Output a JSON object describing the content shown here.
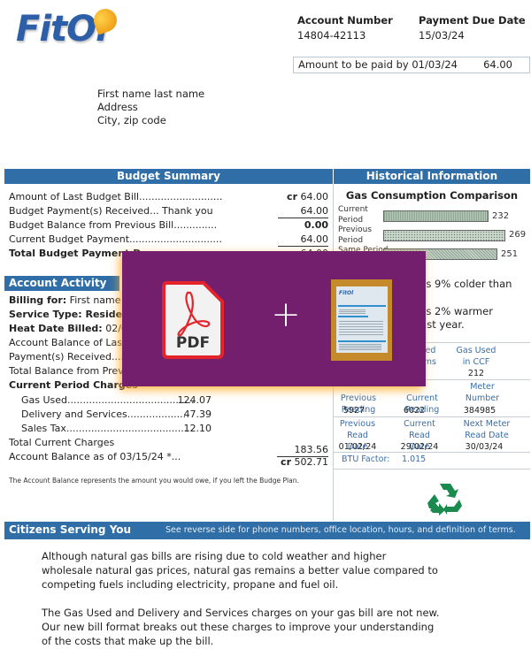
{
  "brand": {
    "logo_text": "FitOl",
    "accent_color": "#2f6ea6"
  },
  "account": {
    "number_label": "Account Number",
    "number": "14804-42113",
    "due_label": "Payment Due Date",
    "due_date": "15/03/24",
    "amount_label": "Amount to be paid by 01/03/24",
    "amount": "64.00"
  },
  "address": {
    "name": "First name last name",
    "street": "Address",
    "city": "City, zip code"
  },
  "budget_summary": {
    "title": "Budget Summary",
    "rows": [
      {
        "label": "Amount of Last Budget Bill...........................",
        "prefix": "cr",
        "value": "64.00"
      },
      {
        "label": "Budget Payment(s) Received... Thank you",
        "prefix": "",
        "value": "64.00"
      },
      {
        "label": "Budget Balance from Previous Bill..............",
        "prefix": "",
        "value": "0.00"
      },
      {
        "label": "Current Budget Payment..............................",
        "prefix": "",
        "value": "64.00"
      },
      {
        "label": "Total Budget Payment D",
        "prefix": "",
        "value": "64.00"
      }
    ]
  },
  "account_activity": {
    "title": "Account Activity",
    "billing_for_label": "Billing for:",
    "billing_for": "First name la",
    "service_type_label": "Service Type: Residenti",
    "heat_date_label": "Heat Date Billed:",
    "heat_date": "02/03/",
    "balance_last": "Account Balance of Last B",
    "payments_received": "Payment(s) Received..... T",
    "total_balance_prev": "Total Balance from Previ",
    "current_period_label": "Current Period Charges",
    "charges": [
      {
        "label": "Gas Used.........................................",
        "value": "124.07"
      },
      {
        "label": "Delivery and Services...................",
        "value": "47.39"
      },
      {
        "label": "Sales Tax.........................................",
        "value": "12.10"
      }
    ],
    "total_current_label": "Total Current Charges",
    "total_current": "183.56",
    "balance_as_of_label": "Account Balance as of 03/15/24  *...",
    "balance_prefix": "cr",
    "balance_as_of": "502.71",
    "footnote": "The Account Balance represents the amount you would owe, if you left the Budge Plan."
  },
  "historical": {
    "title": "Historical Information",
    "chart_title": "Gas Consumption Comparison",
    "bars": [
      {
        "label_line1": "Current",
        "label_line2": "Period",
        "value": 232
      },
      {
        "label_line1": "Previous",
        "label_line2": "Period",
        "value": 269
      },
      {
        "label_line1": "Same Period",
        "label_line2": "",
        "value": 251
      }
    ],
    "note1_line1": "d was 9% colder than",
    "note2_line1": "d was 2% warmer",
    "note2_line2": "od last year.",
    "usage_headers": [
      "sed",
      "rms",
      "Gas Used",
      "in CCF"
    ],
    "gas_ccf": "212",
    "reading_headers": [
      "Previous Reading",
      "Current Reading",
      "Meter Number"
    ],
    "readings": [
      "5927",
      "6022",
      "384985"
    ],
    "date_headers": [
      "Previous Read Date",
      "Current Read Date",
      "Next Meter Read Date"
    ],
    "dates": [
      "01/02/24",
      "29/02/24",
      "30/03/24"
    ],
    "btu_label": "BTU Factor:",
    "btu_value": "1.015"
  },
  "citizens": {
    "title": "Citizens Serving You",
    "note": "See reverse side for phone numbers, office location, hours, and definition of terms."
  },
  "paragraphs": [
    "Although natural gas bills are rising due to cold weather and higher wholesale natural gas prices, natural gas remains a better value compared to competing fuels including electricity, propane and fuel oil.",
    "The Gas Used and Delivery and Services charges on your gas bill are not new. Our new bill format breaks out these charges to improve your understanding of the costs that make up the bill."
  ],
  "overlay": {
    "pdf_label": "PDF",
    "plus": "+",
    "thumbnail_name": "bill-photo"
  }
}
